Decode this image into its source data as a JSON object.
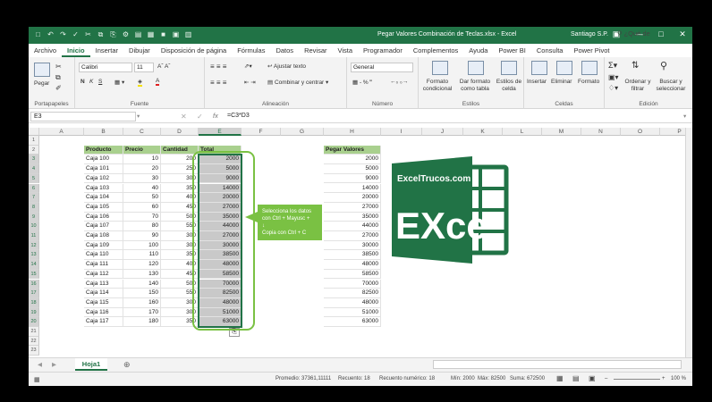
{
  "window": {
    "title": "Pegar Valores Combinación de Teclas.xlsx  -  Excel",
    "user": "Santiago S.P.",
    "controls": [
      "▣",
      "—",
      "□",
      "✕"
    ]
  },
  "quick_access": [
    "□",
    "↶",
    "↷",
    "✓",
    "✂",
    "⧉",
    "⎘",
    "⚙",
    "▤",
    "▦",
    "■",
    "▣",
    "▥"
  ],
  "ribbon_tabs": [
    "Archivo",
    "Inicio",
    "Insertar",
    "Dibujar",
    "Disposición de página",
    "Fórmulas",
    "Datos",
    "Revisar",
    "Vista",
    "Programador",
    "Complementos",
    "Ayuda",
    "Power BI",
    "Consulta",
    "Power Pivot"
  ],
  "active_tab": "Inicio",
  "tell_me": "¿Qué de",
  "ribbon": {
    "clipboard": {
      "paste": "Pegar",
      "label": "Portapapeles"
    },
    "font": {
      "name": "Calibri",
      "size": "11",
      "bold": "N",
      "italic": "K",
      "underline": "S",
      "label": "Fuente"
    },
    "alignment": {
      "wrap": "Ajustar texto",
      "merge": "Combinar y centrar",
      "label": "Alineación"
    },
    "number": {
      "format": "General",
      "label": "Número",
      "currency": "▦ - % ‴"
    },
    "styles": {
      "conditional": "Formato condicional",
      "as_table": "Dar formato como tabla",
      "cell_styles": "Estilos de celda",
      "label": "Estilos"
    },
    "cells": {
      "insert": "Insertar",
      "delete": "Eliminar",
      "format": "Formato",
      "label": "Celdas"
    },
    "editing": {
      "sort": "Ordenar y filtrar",
      "find": "Buscar y seleccionar",
      "label": "Edición"
    }
  },
  "formula_bar": {
    "name_box": "E3",
    "fx": "fx",
    "formula": "=C3*D3"
  },
  "columns": [
    "A",
    "B",
    "C",
    "D",
    "E",
    "F",
    "G",
    "H",
    "I",
    "J",
    "K",
    "L",
    "M",
    "N",
    "O",
    "P"
  ],
  "rows": [
    "1",
    "2",
    "3",
    "4",
    "5",
    "6",
    "7",
    "8",
    "9",
    "10",
    "11",
    "12",
    "13",
    "14",
    "15",
    "16",
    "17",
    "18",
    "19",
    "20",
    "21",
    "22",
    "23"
  ],
  "table": {
    "headers": [
      "Producto",
      "Precio",
      "Cantidad",
      "Total"
    ],
    "rows": [
      [
        "Caja 100",
        "10",
        "200",
        "2000"
      ],
      [
        "Caja 101",
        "20",
        "250",
        "5000"
      ],
      [
        "Caja 102",
        "30",
        "300",
        "9000"
      ],
      [
        "Caja 103",
        "40",
        "350",
        "14000"
      ],
      [
        "Caja 104",
        "50",
        "400",
        "20000"
      ],
      [
        "Caja 105",
        "60",
        "450",
        "27000"
      ],
      [
        "Caja 106",
        "70",
        "500",
        "35000"
      ],
      [
        "Caja 107",
        "80",
        "550",
        "44000"
      ],
      [
        "Caja 108",
        "90",
        "300",
        "27000"
      ],
      [
        "Caja 109",
        "100",
        "300",
        "30000"
      ],
      [
        "Caja 110",
        "110",
        "350",
        "38500"
      ],
      [
        "Caja 111",
        "120",
        "400",
        "48000"
      ],
      [
        "Caja 112",
        "130",
        "450",
        "58500"
      ],
      [
        "Caja 113",
        "140",
        "500",
        "70000"
      ],
      [
        "Caja 114",
        "150",
        "550",
        "82500"
      ],
      [
        "Caja 115",
        "160",
        "300",
        "48000"
      ],
      [
        "Caja 116",
        "170",
        "300",
        "51000"
      ],
      [
        "Caja 117",
        "180",
        "350",
        "63000"
      ]
    ]
  },
  "paste_values": {
    "header": "Pegar Valores",
    "values": [
      "2000",
      "5000",
      "9000",
      "14000",
      "20000",
      "27000",
      "35000",
      "44000",
      "27000",
      "30000",
      "38500",
      "48000",
      "58500",
      "70000",
      "82500",
      "48000",
      "51000",
      "63000"
    ]
  },
  "callout": {
    "line1": "Selecciona los datos",
    "line2": "con Ctrl + Mayusc +",
    "line3": "↓",
    "line4": "Copia con Ctrl + C"
  },
  "logo": {
    "site": "ExcelTrucos.com",
    "word": "EXce"
  },
  "sheet_tab": "Hoja1",
  "status_bar": {
    "average": "Promedio: 37361,11111",
    "count": "Recuento: 18",
    "numeric_count": "Recuento numérico: 18",
    "min": "Mín: 2000",
    "max": "Máx: 82500",
    "sum": "Suma: 672500",
    "zoom": "100 %"
  },
  "colors": {
    "excel_green": "#217346",
    "header_fill": "#a9d08e",
    "annotation_green": "#7ac143"
  }
}
